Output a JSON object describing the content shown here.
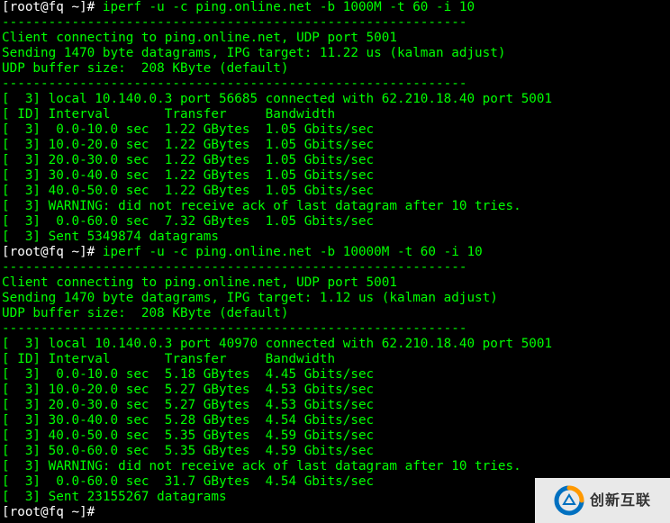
{
  "run1": {
    "prompt1": "[root@fq ~]# ",
    "cmd1": "iperf -u -c ping.online.net -b 1000M -t 60 -i 10",
    "dash": "------------------------------------------------------------",
    "connect_line": "Client connecting to ping.online.net, UDP port 5001",
    "sending_line": "Sending 1470 byte datagrams, IPG target: 11.22 us (kalman adjust)",
    "buffer_line": "UDP buffer size:  208 KByte (default)",
    "local_line": "[  3] local 10.140.0.3 port 56685 connected with 62.210.18.40 port 5001",
    "header_line": "[ ID] Interval       Transfer     Bandwidth",
    "rows": [
      "[  3]  0.0-10.0 sec  1.22 GBytes  1.05 Gbits/sec",
      "[  3] 10.0-20.0 sec  1.22 GBytes  1.05 Gbits/sec",
      "[  3] 20.0-30.0 sec  1.22 GBytes  1.05 Gbits/sec",
      "[  3] 30.0-40.0 sec  1.22 GBytes  1.05 Gbits/sec",
      "[  3] 40.0-50.0 sec  1.22 GBytes  1.05 Gbits/sec"
    ],
    "warning": "[  3] WARNING: did not receive ack of last datagram after 10 tries.",
    "summary": "[  3]  0.0-60.0 sec  7.32 GBytes  1.05 Gbits/sec",
    "sent": "[  3] Sent 5349874 datagrams"
  },
  "run2": {
    "prompt1": "[root@fq ~]# ",
    "cmd1": "iperf -u -c ping.online.net -b 10000M -t 60 -i 10",
    "dash": "------------------------------------------------------------",
    "connect_line": "Client connecting to ping.online.net, UDP port 5001",
    "sending_line": "Sending 1470 byte datagrams, IPG target: 1.12 us (kalman adjust)",
    "buffer_line": "UDP buffer size:  208 KByte (default)",
    "local_line": "[  3] local 10.140.0.3 port 40970 connected with 62.210.18.40 port 5001",
    "header_line": "[ ID] Interval       Transfer     Bandwidth",
    "rows": [
      "[  3]  0.0-10.0 sec  5.18 GBytes  4.45 Gbits/sec",
      "[  3] 10.0-20.0 sec  5.27 GBytes  4.53 Gbits/sec",
      "[  3] 20.0-30.0 sec  5.27 GBytes  4.53 Gbits/sec",
      "[  3] 30.0-40.0 sec  5.28 GBytes  4.54 Gbits/sec",
      "[  3] 40.0-50.0 sec  5.35 GBytes  4.59 Gbits/sec",
      "[  3] 50.0-60.0 sec  5.35 GBytes  4.59 Gbits/sec"
    ],
    "warning": "[  3] WARNING: did not receive ack of last datagram after 10 tries.",
    "summary": "[  3]  0.0-60.0 sec  31.7 GBytes  4.54 Gbits/sec",
    "sent": "[  3] Sent 23155267 datagrams",
    "prompt_end": "[root@fq ~]# "
  },
  "watermark": {
    "text": "创新互联"
  }
}
